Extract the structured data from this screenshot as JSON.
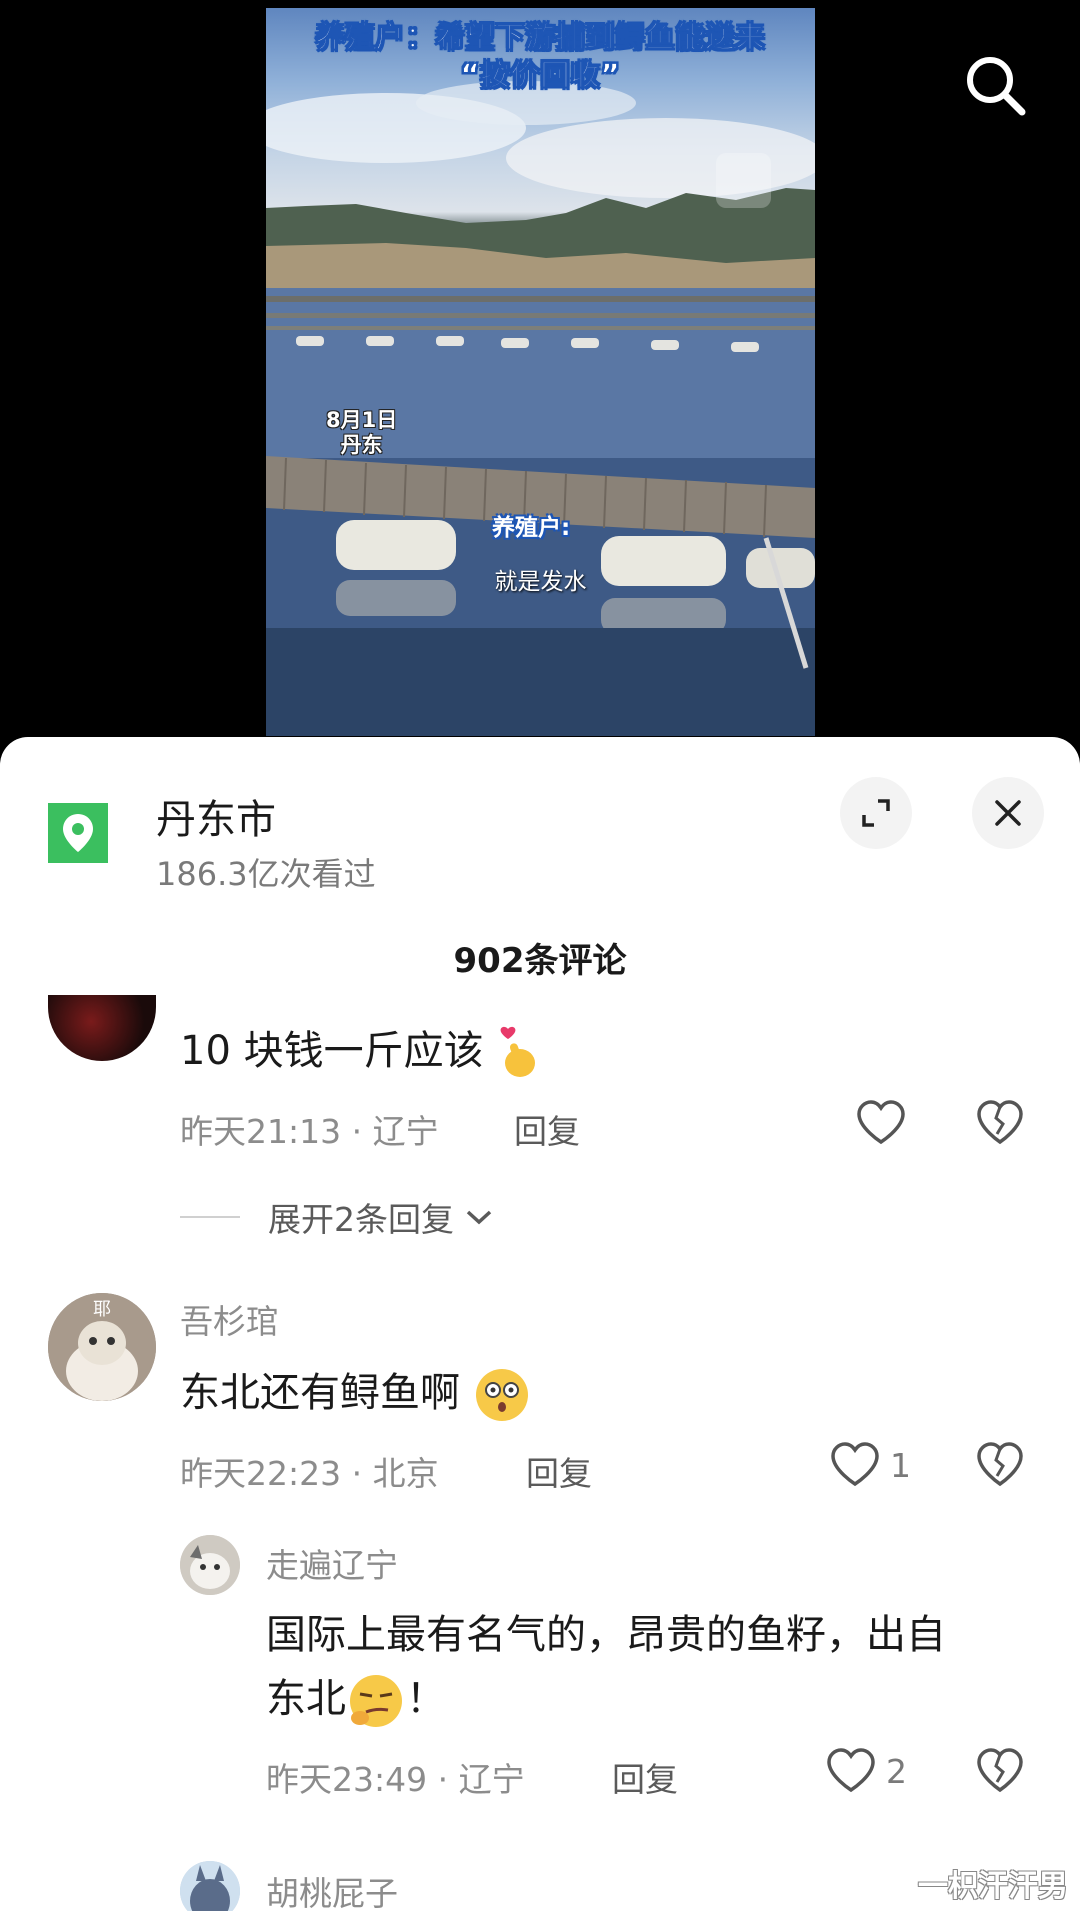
{
  "video": {
    "title_line1": "养殖户：希望下游捕到鲟鱼能送来",
    "title_line2": "“按价回收”",
    "date": "8月1日",
    "place": "丹东",
    "speaker": "养殖户:",
    "subtitle": "就是发水"
  },
  "location": {
    "name": "丹东市",
    "views": "186.3亿次看过"
  },
  "comments_header": {
    "count": "902条评论"
  },
  "comments": [
    {
      "text": "10 块钱一斤应该",
      "emoji": "finger-heart-emoji",
      "meta": "昨天21:13 · 辽宁",
      "reply": "回复",
      "expand_replies": "展开2条回复"
    },
    {
      "username": "吾杉琯",
      "avatar_text": "耶",
      "text": "东北还有鲟鱼啊",
      "emoji": "surprised-face-emoji",
      "meta": "昨天22:23 · 北京",
      "reply": "回复",
      "likes": "1"
    },
    {
      "username": "走遍辽宁",
      "text_line1": "国际上最有名气的，昂贵的鱼籽，出自",
      "text_line2_before": "东北",
      "text_line2_after": "！",
      "emoji": "smug-face-emoji",
      "meta": "昨天23:49 · 辽宁",
      "reply": "回复",
      "likes": "2"
    },
    {
      "username": "胡桃屁子"
    }
  ],
  "watermark": "一枳汗汗男",
  "colors": {
    "location_green": "#3bbf5f",
    "title_blue": "#1e56b5"
  }
}
